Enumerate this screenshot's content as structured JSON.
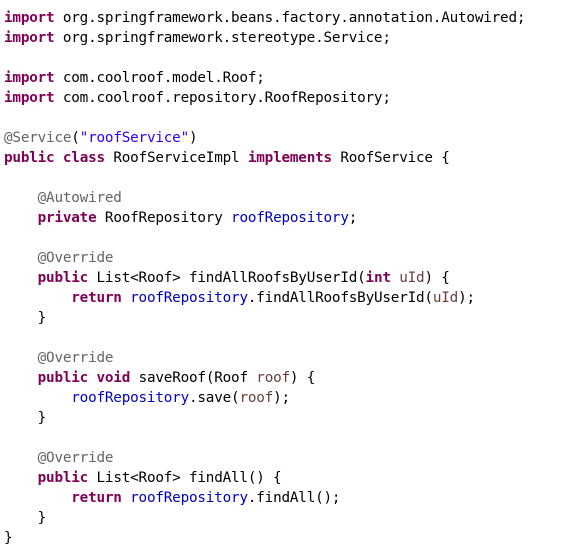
{
  "editor": {
    "colors": {
      "keyword": "#7f0055",
      "annotation": "#646464",
      "string": "#2a00ff",
      "field": "#0000c0",
      "parameter": "#6a3e3e",
      "default": "#000000",
      "background": "#ffffff"
    },
    "lines": [
      [
        {
          "t": "import",
          "c": "kw"
        },
        {
          "t": " org.springframework.beans.factory.annotation.Autowired;",
          "c": "plain"
        }
      ],
      [
        {
          "t": "import",
          "c": "kw"
        },
        {
          "t": " org.springframework.stereotype.Service;",
          "c": "plain"
        }
      ],
      [],
      [
        {
          "t": "import",
          "c": "kw"
        },
        {
          "t": " com.coolroof.model.Roof;",
          "c": "plain"
        }
      ],
      [
        {
          "t": "import",
          "c": "kw"
        },
        {
          "t": " com.coolroof.repository.RoofRepository;",
          "c": "plain"
        }
      ],
      [],
      [
        {
          "t": "@Service",
          "c": "ann"
        },
        {
          "t": "(",
          "c": "plain"
        },
        {
          "t": "\"roofService\"",
          "c": "str"
        },
        {
          "t": ")",
          "c": "plain"
        }
      ],
      [
        {
          "t": "public",
          "c": "kw"
        },
        {
          "t": " ",
          "c": "plain"
        },
        {
          "t": "class",
          "c": "kw"
        },
        {
          "t": " RoofServiceImpl ",
          "c": "plain"
        },
        {
          "t": "implements",
          "c": "kw"
        },
        {
          "t": " RoofService {",
          "c": "plain"
        }
      ],
      [],
      [
        {
          "t": "    ",
          "c": "plain"
        },
        {
          "t": "@Autowired",
          "c": "ann"
        }
      ],
      [
        {
          "t": "    ",
          "c": "plain"
        },
        {
          "t": "private",
          "c": "kw"
        },
        {
          "t": " RoofRepository ",
          "c": "plain"
        },
        {
          "t": "roofRepository",
          "c": "fld"
        },
        {
          "t": ";",
          "c": "plain"
        }
      ],
      [],
      [
        {
          "t": "    ",
          "c": "plain"
        },
        {
          "t": "@Override",
          "c": "ann"
        }
      ],
      [
        {
          "t": "    ",
          "c": "plain"
        },
        {
          "t": "public",
          "c": "kw"
        },
        {
          "t": " List<Roof> findAllRoofsByUserId(",
          "c": "plain"
        },
        {
          "t": "int",
          "c": "kw"
        },
        {
          "t": " ",
          "c": "plain"
        },
        {
          "t": "uId",
          "c": "param"
        },
        {
          "t": ") {",
          "c": "plain"
        }
      ],
      [
        {
          "t": "        ",
          "c": "plain"
        },
        {
          "t": "return",
          "c": "kw"
        },
        {
          "t": " ",
          "c": "plain"
        },
        {
          "t": "roofRepository",
          "c": "fld"
        },
        {
          "t": ".findAllRoofsByUserId(",
          "c": "plain"
        },
        {
          "t": "uId",
          "c": "param"
        },
        {
          "t": ");",
          "c": "plain"
        }
      ],
      [
        {
          "t": "    }",
          "c": "plain"
        }
      ],
      [],
      [
        {
          "t": "    ",
          "c": "plain"
        },
        {
          "t": "@Override",
          "c": "ann"
        }
      ],
      [
        {
          "t": "    ",
          "c": "plain"
        },
        {
          "t": "public",
          "c": "kw"
        },
        {
          "t": " ",
          "c": "plain"
        },
        {
          "t": "void",
          "c": "kw"
        },
        {
          "t": " saveRoof(Roof ",
          "c": "plain"
        },
        {
          "t": "roof",
          "c": "param"
        },
        {
          "t": ") {",
          "c": "plain"
        }
      ],
      [
        {
          "t": "        ",
          "c": "plain"
        },
        {
          "t": "roofRepository",
          "c": "fld"
        },
        {
          "t": ".save(",
          "c": "plain"
        },
        {
          "t": "roof",
          "c": "param"
        },
        {
          "t": ");",
          "c": "plain"
        }
      ],
      [
        {
          "t": "    }",
          "c": "plain"
        }
      ],
      [],
      [
        {
          "t": "    ",
          "c": "plain"
        },
        {
          "t": "@Override",
          "c": "ann"
        }
      ],
      [
        {
          "t": "    ",
          "c": "plain"
        },
        {
          "t": "public",
          "c": "kw"
        },
        {
          "t": " List<Roof> findAll() {",
          "c": "plain"
        }
      ],
      [
        {
          "t": "        ",
          "c": "plain"
        },
        {
          "t": "return",
          "c": "kw"
        },
        {
          "t": " ",
          "c": "plain"
        },
        {
          "t": "roofRepository",
          "c": "fld"
        },
        {
          "t": ".findAll();",
          "c": "plain"
        }
      ],
      [
        {
          "t": "    }",
          "c": "plain"
        }
      ],
      [
        {
          "t": "}",
          "c": "plain"
        }
      ]
    ]
  }
}
